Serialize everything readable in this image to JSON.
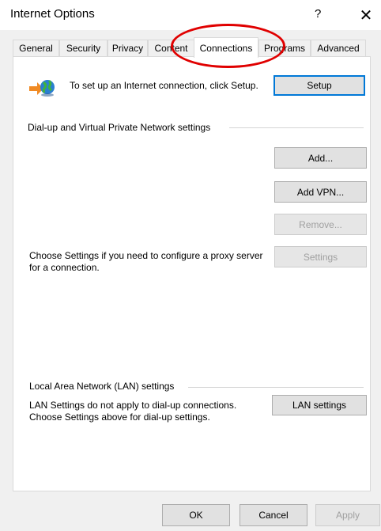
{
  "window": {
    "title": "Internet Options",
    "help_glyph": "?",
    "close_glyph": "✕"
  },
  "tabs": [
    {
      "label": "General"
    },
    {
      "label": "Security"
    },
    {
      "label": "Privacy"
    },
    {
      "label": "Content"
    },
    {
      "label": "Connections",
      "active": true
    },
    {
      "label": "Programs"
    },
    {
      "label": "Advanced"
    }
  ],
  "setup": {
    "text": "To set up an Internet connection, click Setup.",
    "button": "Setup"
  },
  "dialup": {
    "header": "Dial-up and Virtual Private Network settings",
    "add": "Add...",
    "add_vpn": "Add VPN...",
    "remove": "Remove...",
    "proxy_text": "Choose Settings if you need to configure a proxy server for a connection.",
    "settings": "Settings"
  },
  "lan": {
    "header": "Local Area Network (LAN) settings",
    "text": "LAN Settings do not apply to dial-up connections. Choose Settings above for dial-up settings.",
    "button": "LAN settings"
  },
  "footer": {
    "ok": "OK",
    "cancel": "Cancel",
    "apply": "Apply"
  },
  "annotation": {
    "color": "#e00000"
  }
}
